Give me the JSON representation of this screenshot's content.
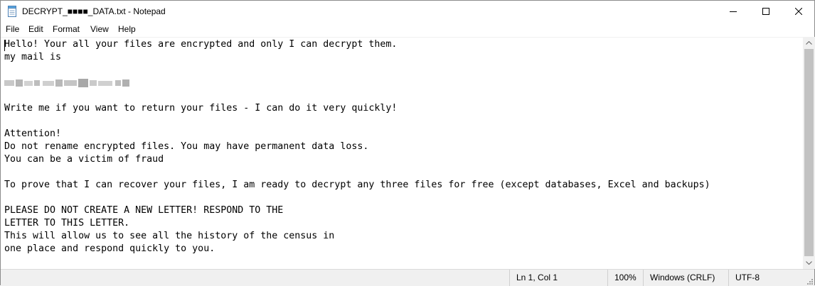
{
  "window": {
    "title": "DECRYPT_■■■■_DATA.txt - Notepad"
  },
  "menu": {
    "file": "File",
    "edit": "Edit",
    "format": "Format",
    "view": "View",
    "help": "Help"
  },
  "document": {
    "lines": [
      "Hello! Your all your files are encrypted and only I can decrypt them.",
      "my mail is",
      "",
      "",
      "",
      "Write me if you want to return your files - I can do it very quickly!",
      "",
      "Attention!",
      "Do not rename encrypted files. You may have permanent data loss.",
      "You can be a victim of fraud",
      "",
      "To prove that I can recover your files, I am ready to decrypt any three files for free (except databases, Excel and backups)",
      "",
      "PLEASE DO NOT CREATE A NEW LETTER! RESPOND TO THE",
      "LETTER TO THIS LETTER.",
      "This will allow us to see all the history of the census in",
      "one place and respond quickly to you."
    ]
  },
  "status": {
    "position": "Ln 1, Col 1",
    "zoom": "100%",
    "line_ending": "Windows (CRLF)",
    "encoding": "UTF-8"
  },
  "icons": {
    "app": "notepad-icon",
    "minimize": "minimize-icon",
    "maximize": "maximize-icon",
    "close": "close-icon"
  }
}
